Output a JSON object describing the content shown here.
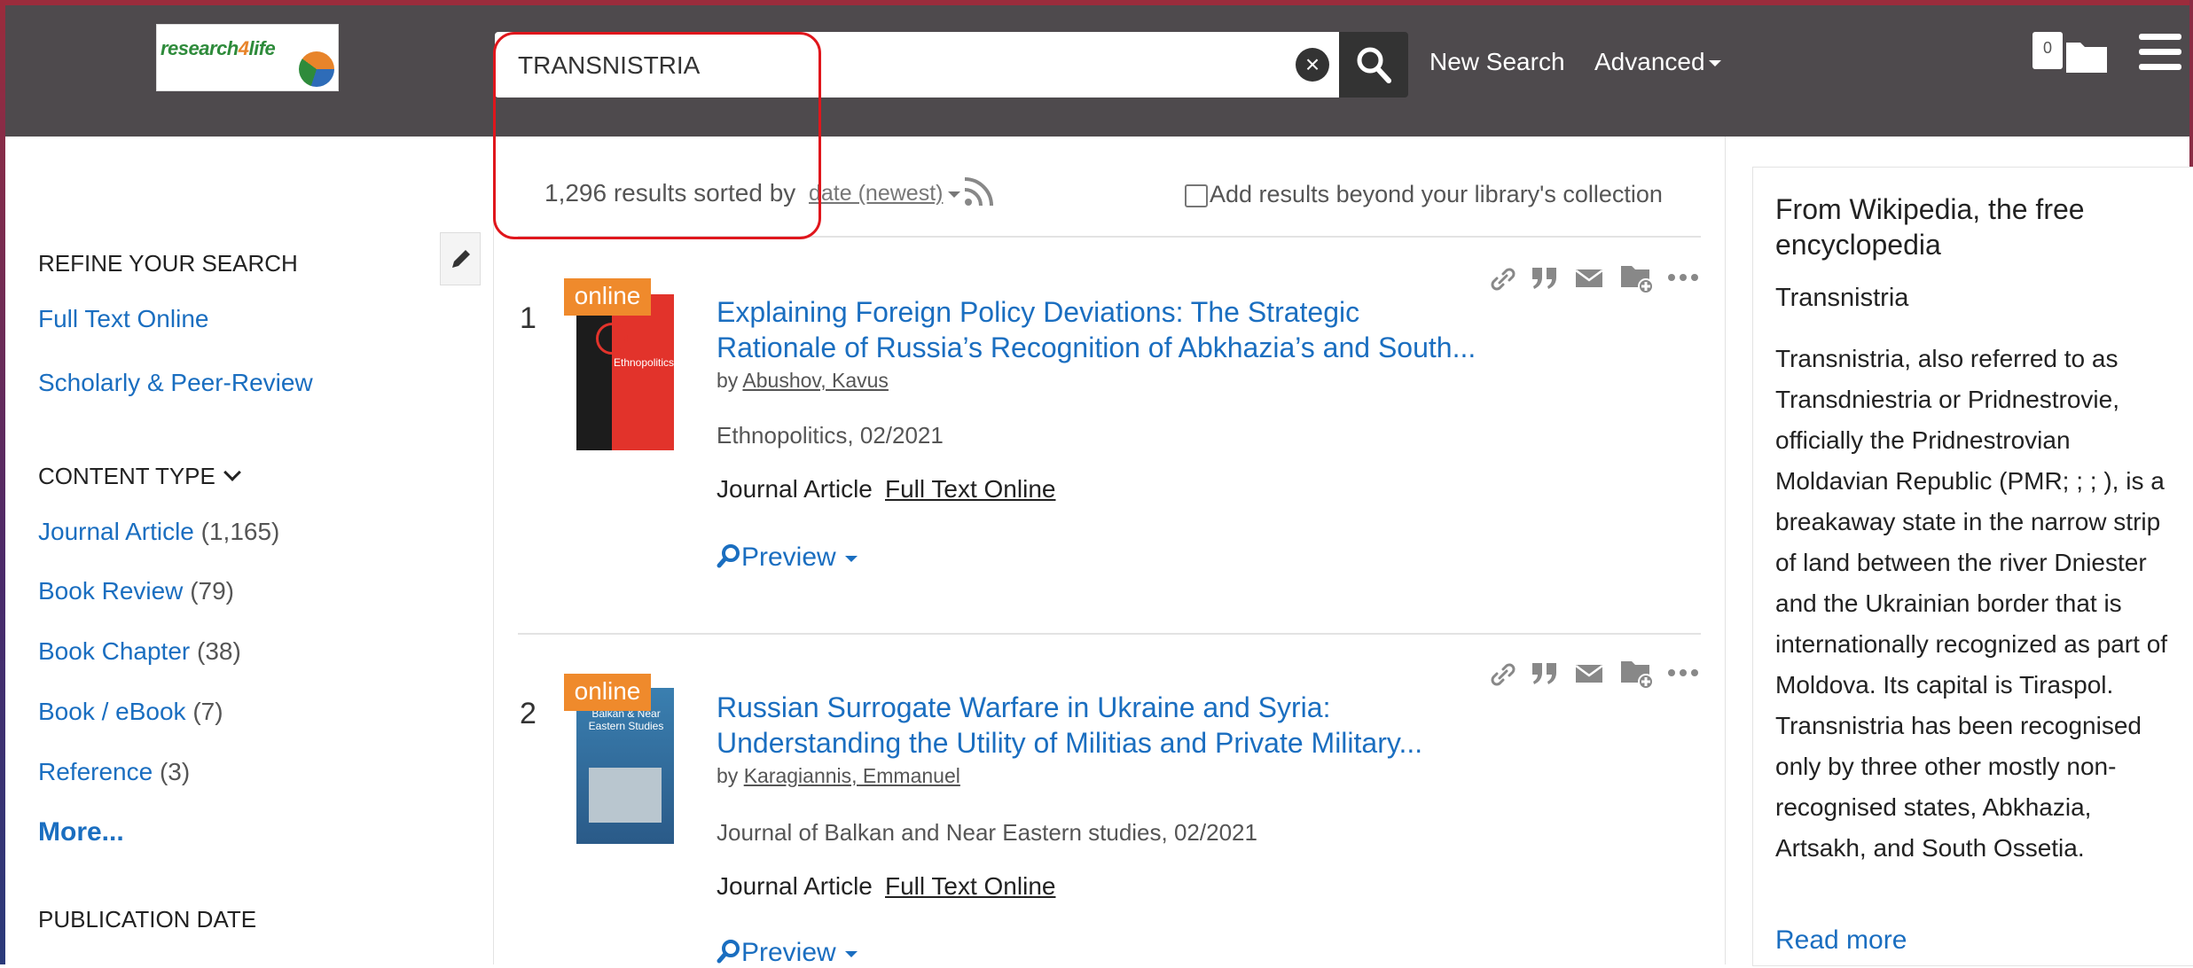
{
  "header": {
    "logo_text_a": "research",
    "logo_text_num": "4",
    "logo_text_b": "life",
    "search_value": "TRANSNISTRIA",
    "new_search_label": "New Search",
    "advanced_label": "Advanced",
    "folder_count": "0"
  },
  "sidebar": {
    "refine_heading": "REFINE YOUR SEARCH",
    "refine_links": [
      "Full Text Online",
      "Scholarly & Peer-Review"
    ],
    "content_type_heading": "CONTENT TYPE",
    "content_types": [
      {
        "label": "Journal Article",
        "count": "(1,165)"
      },
      {
        "label": "Book Review",
        "count": "(79)"
      },
      {
        "label": "Book Chapter",
        "count": "(38)"
      },
      {
        "label": "Book / eBook",
        "count": "(7)"
      },
      {
        "label": "Reference",
        "count": "(3)"
      }
    ],
    "more_label": "More...",
    "publication_date_heading": "PUBLICATION DATE"
  },
  "results_bar": {
    "count_text": "1,296 results sorted by",
    "sort_value": "date (newest)",
    "beyond_label": "Add results beyond your library's collection"
  },
  "results": [
    {
      "number": "1",
      "badge": "online",
      "cover_text": "Ethnopolitics",
      "title_line1": "Explaining Foreign Policy Deviations: The Strategic",
      "title_line2": "Rationale of Russia’s Recognition of Abkhazia’s and South...",
      "by": "by",
      "author": "Abushov, Kavus",
      "publication": "Ethnopolitics, 02/2021",
      "type": "Journal Article",
      "fulltext": "Full Text Online",
      "preview": "Preview"
    },
    {
      "number": "2",
      "badge": "online",
      "cover_text": "Balkan & Near Eastern Studies",
      "title_line1": "Russian Surrogate Warfare in Ukraine and Syria:",
      "title_line2": "Understanding the Utility of Militias and Private Military...",
      "by": "by",
      "author": "Karagiannis, Emmanuel",
      "publication": "Journal of Balkan and Near Eastern studies, 02/2021",
      "type": "Journal Article",
      "fulltext": "Full Text Online",
      "preview": "Preview"
    }
  ],
  "wiki": {
    "source": "From Wikipedia, the free encyclopedia",
    "title": "Transnistria",
    "body": "Transnistria, also referred to as Transdniestria or Pridnestrovie, officially the Pridnestrovian Moldavian Republic (PMR; ; ; ), is a breakaway state in the narrow strip of land between the river Dniester and the Ukrainian border that is internationally recognized as part of Moldova. Its capital is Tiraspol. Transnistria has been recognised only by three other mostly non-recognised states, Abkhazia, Artsakh, and South Ossetia.",
    "read_more": "Read more"
  },
  "colors": {
    "header_bg": "#4e4a4d",
    "link_blue": "#1a6ec0",
    "online_orange": "#ef8a2c",
    "highlight_red": "#e0161c"
  }
}
